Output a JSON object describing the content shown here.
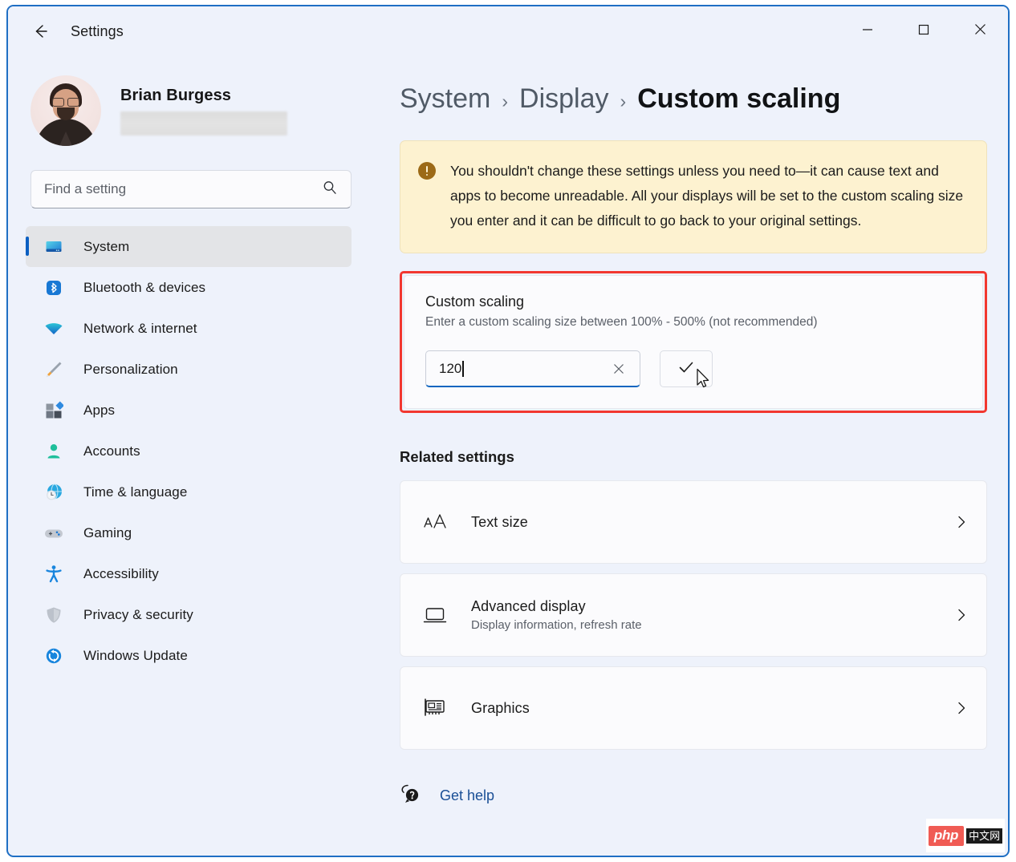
{
  "window": {
    "title": "Settings",
    "back_icon": "back-arrow-icon",
    "controls": {
      "minimize": "minimize-icon",
      "maximize": "maximize-icon",
      "close": "close-icon"
    }
  },
  "colors": {
    "accent": "#0b5fc2",
    "highlight_box": "#f2372f",
    "warning_bg": "#fdf2d0",
    "warning_icon": "#9c6a17",
    "link": "#1a4f96",
    "window_border": "#1f6fc4"
  },
  "sidebar": {
    "profile": {
      "name": "Brian Burgess",
      "email_redacted": true
    },
    "search": {
      "placeholder": "Find a setting",
      "value": "",
      "icon": "search-icon"
    },
    "items": [
      {
        "label": "System",
        "icon": "monitor-icon",
        "selected": true
      },
      {
        "label": "Bluetooth & devices",
        "icon": "bluetooth-icon",
        "selected": false
      },
      {
        "label": "Network & internet",
        "icon": "wifi-icon",
        "selected": false
      },
      {
        "label": "Personalization",
        "icon": "paintbrush-icon",
        "selected": false
      },
      {
        "label": "Apps",
        "icon": "apps-icon",
        "selected": false
      },
      {
        "label": "Accounts",
        "icon": "person-icon",
        "selected": false
      },
      {
        "label": "Time & language",
        "icon": "clock-globe-icon",
        "selected": false
      },
      {
        "label": "Gaming",
        "icon": "gamepad-icon",
        "selected": false
      },
      {
        "label": "Accessibility",
        "icon": "accessibility-icon",
        "selected": false
      },
      {
        "label": "Privacy & security",
        "icon": "shield-icon",
        "selected": false
      },
      {
        "label": "Windows Update",
        "icon": "update-icon",
        "selected": false
      }
    ]
  },
  "main": {
    "breadcrumb": {
      "level1": "System",
      "sep1": "›",
      "level2": "Display",
      "sep2": "›",
      "level3": "Custom scaling"
    },
    "warning": {
      "icon": "warning-icon",
      "text": "You shouldn't change these settings unless you need to—it can cause text and apps to become unreadable. All your displays will be set to the custom scaling size you enter and it can be difficult to go back to your original settings."
    },
    "custom_scaling": {
      "title": "Custom scaling",
      "subtitle": "Enter a custom scaling size between 100% - 500% (not recommended)",
      "input_value": "120",
      "input_placeholder": "",
      "clear_icon": "clear-x-icon",
      "confirm_icon": "checkmark-icon",
      "highlighted": true
    },
    "related_settings": {
      "heading": "Related settings",
      "cards": [
        {
          "label": "Text size",
          "sub": "",
          "icon": "text-size-icon",
          "chevron": "chevron-right-icon"
        },
        {
          "label": "Advanced display",
          "sub": "Display information, refresh rate",
          "icon": "laptop-display-icon",
          "chevron": "chevron-right-icon"
        },
        {
          "label": "Graphics",
          "sub": "",
          "icon": "graphics-card-icon",
          "chevron": "chevron-right-icon"
        }
      ]
    },
    "get_help": {
      "label": "Get help",
      "icon": "help-bubble-icon"
    }
  },
  "watermark": {
    "php": "php",
    "cn": "中文网"
  }
}
